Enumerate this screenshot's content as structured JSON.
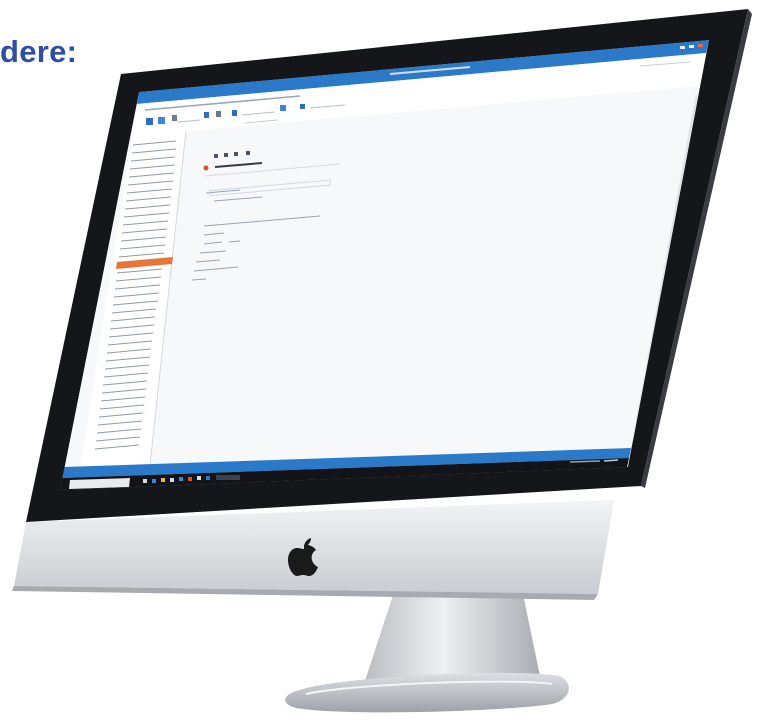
{
  "heading": {
    "text": "dere:"
  },
  "colors": {
    "heading": "#2f4fa3",
    "titlebar": "#2b79c9",
    "taskbar": "#12141a",
    "highlight": "#e8753a",
    "bezel": "#15161a"
  },
  "app": {
    "window_title": "",
    "record_title": "",
    "toolbar_groups": 6
  },
  "sidebar": {
    "rows": 38,
    "highlighted_row": 16
  },
  "form": {
    "rows": 8
  },
  "taskbar": {
    "search_placeholder": "",
    "pinned_apps": 9,
    "clock": ""
  },
  "device": {
    "logo": "apple-logo-icon"
  }
}
